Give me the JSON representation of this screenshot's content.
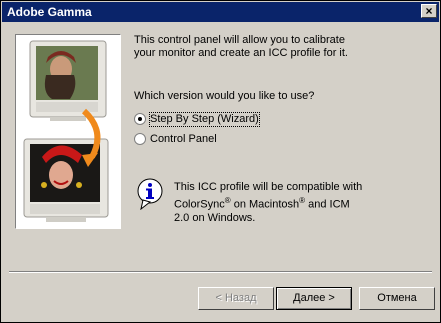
{
  "window": {
    "title": "Adobe Gamma"
  },
  "intro": {
    "line1": "This control panel will allow you to calibrate",
    "line2": "your monitor and create an ICC profile for it."
  },
  "question": "Which version would you like to use?",
  "options": [
    {
      "label": "Step By Step (Wizard)",
      "selected": true
    },
    {
      "label": "Control Panel",
      "selected": false
    }
  ],
  "info": {
    "line1": "This ICC profile will be compatible with",
    "line2_a": "ColorSync",
    "reg1": "®",
    "line2_b": " on Macintosh",
    "reg2": "®",
    "line2_c": " and ICM",
    "line3": "2.0 on Windows."
  },
  "buttons": {
    "back": "< Назад",
    "next": "Далее >",
    "cancel": "Отмена"
  },
  "colors": {
    "titlebar": "#0a246a",
    "face": "#d4d0c8",
    "arrow": "#f08a1c"
  }
}
